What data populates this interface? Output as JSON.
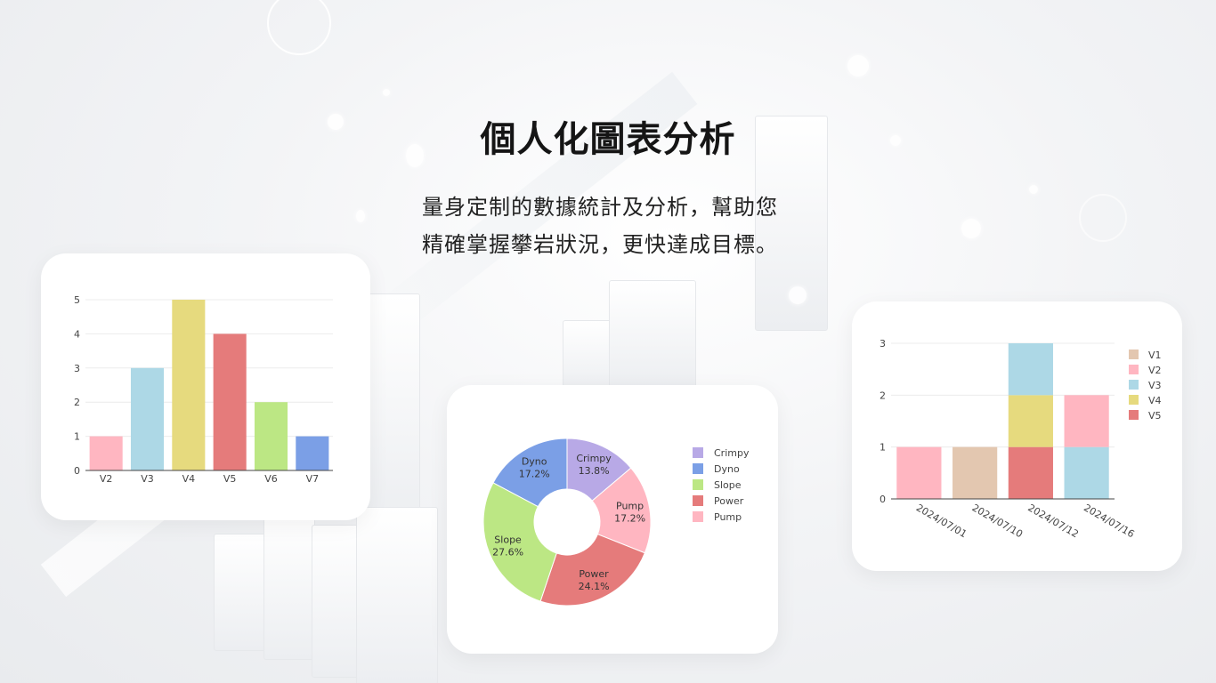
{
  "hero": {
    "title": "個人化圖表分析",
    "desc_line1": "量身定制的數據統計及分析，幫助您",
    "desc_line2": "精確掌握攀岩狀況，更快達成目標。"
  },
  "colors": {
    "pink": "#FFB6C1",
    "blue": "#ADD8E6",
    "yellow": "#E6DA7E",
    "red": "#E57B7B",
    "green": "#BCE784",
    "cornflower": "#7B9FE6",
    "lavender": "#B8A9E6",
    "tan": "#E3C7B0"
  },
  "chart_data": [
    {
      "type": "bar",
      "categories": [
        "V2",
        "V3",
        "V4",
        "V5",
        "V6",
        "V7"
      ],
      "values": [
        1,
        3,
        5,
        4,
        2,
        1
      ],
      "colors": [
        "#FFB6C1",
        "#ADD8E6",
        "#E6DA7E",
        "#E57B7B",
        "#BCE784",
        "#7B9FE6"
      ],
      "ylim": [
        0,
        5
      ],
      "yticks": [
        0,
        1,
        2,
        3,
        4,
        5
      ],
      "grid": true
    },
    {
      "type": "pie",
      "hole": true,
      "categories": [
        "Crimpy",
        "Pump",
        "Power",
        "Slope",
        "Dyno"
      ],
      "values": [
        13.8,
        17.2,
        24.1,
        27.6,
        17.2
      ],
      "labels": [
        "13.8%",
        "17.2%",
        "24.1%",
        "27.6%",
        "17.2%"
      ],
      "colors": [
        "#B8A9E6",
        "#FFB6C1",
        "#E57B7B",
        "#BCE784",
        "#7B9FE6"
      ],
      "legend": [
        "Crimpy",
        "Dyno",
        "Slope",
        "Power",
        "Pump"
      ],
      "legend_colors": [
        "#B8A9E6",
        "#7B9FE6",
        "#BCE784",
        "#E57B7B",
        "#FFB6C1"
      ],
      "legend_placement": "right"
    },
    {
      "type": "bar",
      "stacked": true,
      "categories": [
        "2024/07/01",
        "2024/07/10",
        "2024/07/12",
        "2024/07/16"
      ],
      "series": [
        {
          "name": "V1",
          "color": "#E3C7B0",
          "values": [
            0,
            1,
            0,
            0
          ]
        },
        {
          "name": "V2",
          "color": "#FFB6C1",
          "values": [
            1,
            0,
            0,
            1
          ]
        },
        {
          "name": "V3",
          "color": "#ADD8E6",
          "values": [
            0,
            0,
            1,
            1
          ]
        },
        {
          "name": "V4",
          "color": "#E6DA7E",
          "values": [
            0,
            0,
            1,
            0
          ]
        },
        {
          "name": "V5",
          "color": "#E57B7B",
          "values": [
            0,
            0,
            1,
            0
          ]
        }
      ],
      "stack_order": [
        "V5",
        "V4",
        "V3",
        "V2",
        "V1"
      ],
      "ylim": [
        0,
        3
      ],
      "yticks": [
        0,
        1,
        2,
        3
      ],
      "grid": true,
      "legend_placement": "top-right"
    }
  ]
}
